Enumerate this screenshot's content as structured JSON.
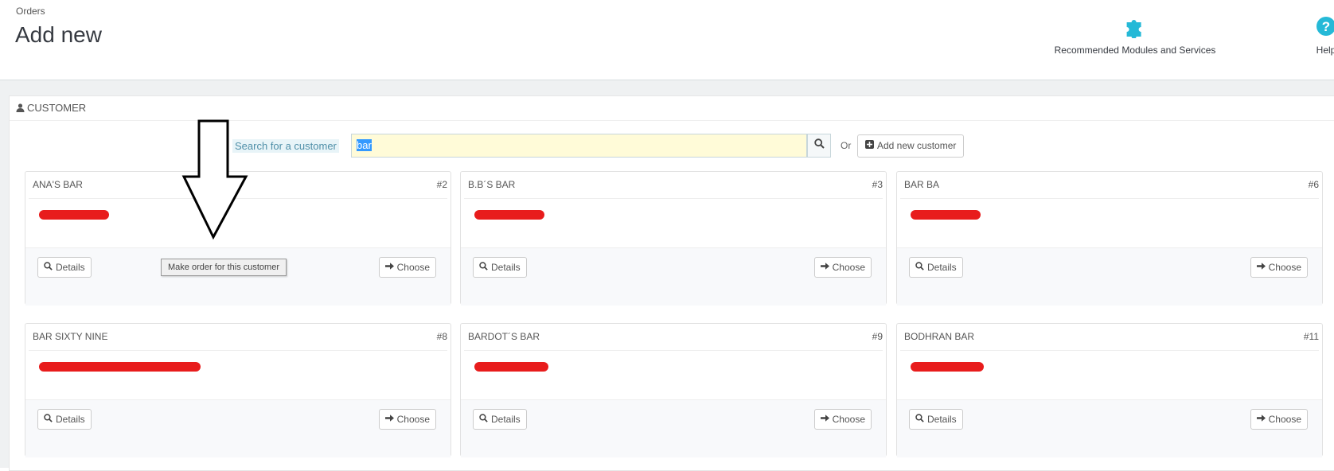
{
  "header": {
    "breadcrumb": "Orders",
    "title": "Add new",
    "toolbar": {
      "modules_label": "Recommended Modules and Services",
      "help_label": "Help",
      "modules_icon": "puzzle-icon",
      "help_icon": "question-circle-icon",
      "accent_color": "#25b9d7"
    }
  },
  "panel": {
    "heading": "CUSTOMER",
    "heading_icon": "user-icon"
  },
  "search": {
    "label": "Search for a customer",
    "value": "bar",
    "or_label": "Or",
    "add_button_label": "Add new customer"
  },
  "customers": [
    {
      "name": "ANA'S BAR",
      "id": "#2"
    },
    {
      "name": "B.B´S BAR",
      "id": "#3"
    },
    {
      "name": "BAR BA",
      "id": "#6"
    },
    {
      "name": "BAR SIXTY NINE",
      "id": "#8"
    },
    {
      "name": "BARDOT´S BAR",
      "id": "#9"
    },
    {
      "name": "BODHRAN BAR",
      "id": "#11"
    }
  ],
  "card_buttons": {
    "details": "Details",
    "choose": "Choose"
  },
  "tooltip": "Make order for this customer",
  "colors": {
    "redaction": "#e81c1c",
    "search_bg": "#fffbd8",
    "selection": "#3399ff"
  }
}
